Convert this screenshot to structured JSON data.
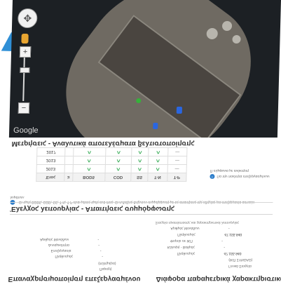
{
  "map": {
    "google_label": "Google",
    "attribution": "",
    "controls": {
      "navigation_icon": "compass-pan-icon",
      "pegman_icon": "pegman-icon",
      "zoom_in": "+",
      "zoom_out": "−"
    },
    "markers": [
      {
        "name": "monitoring-point-green",
        "color": "#35b23a"
      },
      {
        "name": "monitoring-point-blue",
        "color": "#2a66e0"
      },
      {
        "name": "monitoring-point-blue-2",
        "color": "#2a66e0"
      }
    ]
  },
  "sections": {
    "measurements_title": "Μετρήσεις - Αναλυτικά αποτελέσματα βελτιστοποίησης",
    "pollution_control_title": "Έλεγχος λειτουργίας - Απαιτήσεις συμμόρφωσης",
    "left_bottom_title": "Επαναχρησιμοποίηση επεξεργασμένου",
    "right_bottom_title": "Διάφορα παραμετρικά χαρακτηριστικά"
  },
  "table": {
    "header": [
      "Έτος",
      "≥",
      "BOD5",
      "COD",
      "SS",
      "T-N",
      "T-P"
    ],
    "rows": [
      {
        "year": "2017",
        "cells": [
          "^",
          "^",
          "^",
          "^",
          "—"
        ]
      },
      {
        "year": "2013",
        "cells": [
          "^",
          "^",
          "^",
          "^",
          "—"
        ]
      },
      {
        "year": "2013",
        "cells": [
          "^",
          "^",
          "^",
          "^",
          "—"
        ]
      }
    ]
  },
  "legend": {
    "items": [
      "Π σύμφωνα με ανάκτηση",
      "Για την ποιότητα επεξεργασμένων"
    ]
  },
  "note": {
    "text": "Οι τιμές BOD5, COD, SS, T-N, T-P είναι μέσες τιμές ανά έτος. Οι ενδείξεις δείχνουν συμμόρφωση με τις απαιτήσεις της οδηγίας για επεξεργασία αστικών λυμάτων."
  },
  "stats": {
    "header": "Στοιχεία εγκατάστασης και χαρακτηριστικά λειτουργίας",
    "left": [
      {
        "label": "Αριθμός Μονάδων",
        "value": "-"
      },
      {
        "label": "Δυναμικότητα",
        "value": "-"
      },
      {
        "label": "Επεξεργασία",
        "value": "-"
      },
      {
        "label": "Πληθυσμός",
        "value": "-"
      },
      {
        "label": "",
        "value": "(m3/ημέρα)"
      },
      {
        "label": "",
        "value": "Παροχή"
      }
    ],
    "right": [
      {
        "label": "Αριθμός Μονάδων",
        "value": "-"
      },
      {
        "label": "Πληθυσμός",
        "value": "47.155.940"
      },
      {
        "label": "Φορτίο σε ΙΚΠ",
        "value": "-"
      },
      {
        "label": "Κάλυψη - Βαθμός",
        "value": "-"
      },
      {
        "label": "Πληθυσμός",
        "value": "47.155.940"
      },
      {
        "label": "",
        "value": "(ΙΚΠ ΣΥΝΟΛΟ)"
      },
      {
        "label": "",
        "value": "Γενικά Στοιχεία"
      }
    ]
  },
  "colors": {
    "accent": "#2f8fd6",
    "ok_chevron": "#2fa84f",
    "marker_green": "#35b23a",
    "marker_blue": "#2a66e0"
  }
}
